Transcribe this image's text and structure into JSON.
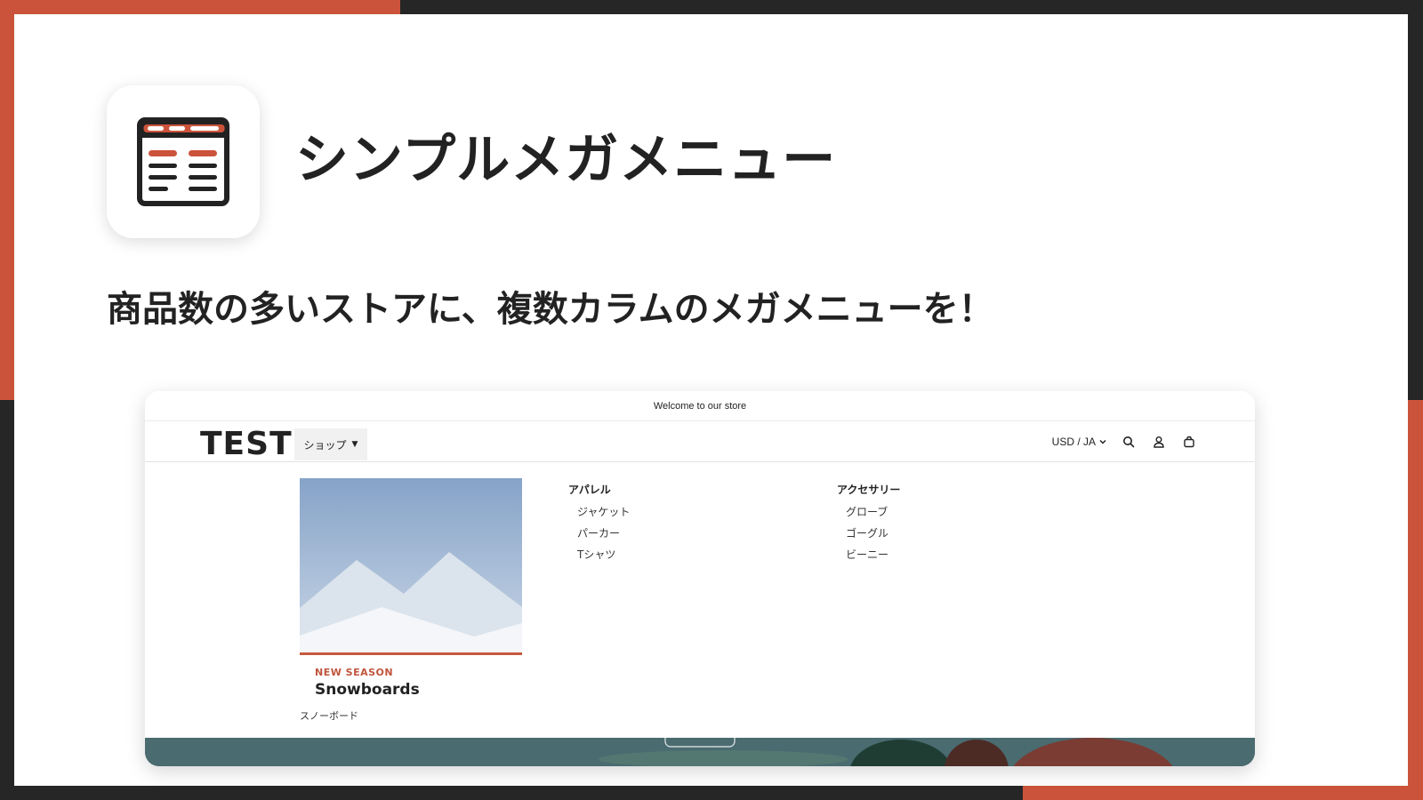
{
  "app": {
    "title": "シンプルメガメニュー",
    "tagline": "商品数の多いストアに、複数カラムのメガメニューを！",
    "icon": "mega-menu-icon"
  },
  "colors": {
    "accent": "#cc533b",
    "frame": "#262626",
    "text": "#222222",
    "eyebrow": "#c0553c"
  },
  "store": {
    "announcement": "Welcome to our store",
    "logo": "TEST",
    "nav": {
      "shop_label": "ショップ"
    },
    "locale": "USD / JA",
    "icons": [
      "search-icon",
      "account-icon",
      "cart-icon"
    ],
    "mega_menu": {
      "feature": {
        "eyebrow": "NEW SEASON",
        "title": "Snowboards",
        "link": "スノーボード"
      },
      "columns": [
        {
          "heading": "アパレル",
          "items": [
            "ジャケット",
            "パーカー",
            "Tシャツ"
          ]
        },
        {
          "heading": "アクセサリー",
          "items": [
            "グローブ",
            "ゴーグル",
            "ビーニー"
          ]
        }
      ]
    }
  }
}
